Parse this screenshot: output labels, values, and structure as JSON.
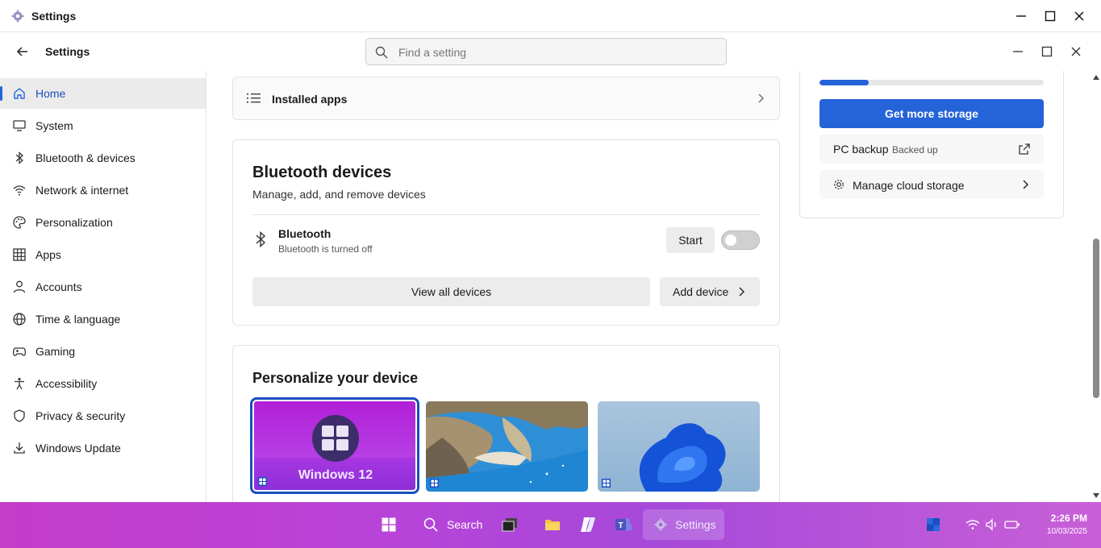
{
  "window": {
    "title": "Settings"
  },
  "header": {
    "title": "Settings",
    "search_placeholder": "Find a setting"
  },
  "sidebar": {
    "items": [
      {
        "label": "Home",
        "icon": "home-icon",
        "active": true
      },
      {
        "label": "System",
        "icon": "monitor-icon"
      },
      {
        "label": "Bluetooth & devices",
        "icon": "bluetooth-icon"
      },
      {
        "label": "Network & internet",
        "icon": "wifi-icon"
      },
      {
        "label": "Personalization",
        "icon": "palette-icon"
      },
      {
        "label": "Apps",
        "icon": "apps-grid-icon"
      },
      {
        "label": "Accounts",
        "icon": "person-icon"
      },
      {
        "label": "Time & language",
        "icon": "globe-icon"
      },
      {
        "label": "Gaming",
        "icon": "gamepad-icon"
      },
      {
        "label": "Accessibility",
        "icon": "accessibility-icon"
      },
      {
        "label": "Privacy & security",
        "icon": "shield-icon"
      },
      {
        "label": "Windows Update",
        "icon": "download-icon"
      }
    ]
  },
  "main": {
    "installed_apps": {
      "label": "Installed apps"
    },
    "bluetooth": {
      "title": "Bluetooth devices",
      "subtitle": "Manage, add, and remove devices",
      "device_name": "Bluetooth",
      "device_status": "Bluetooth is turned off",
      "start_label": "Start",
      "toggle_on": false,
      "view_all_label": "View all devices",
      "add_device_label": "Add device"
    },
    "personalize": {
      "title": "Personalize your device",
      "wallpaper_text": "Windows 12",
      "wallpapers": [
        "windows-12-wallpaper",
        "beach-cove-wallpaper",
        "blue-bloom-wallpaper"
      ],
      "selected_index": 0
    }
  },
  "storage": {
    "usage_fraction": 0.22,
    "get_more_label": "Get more storage",
    "pc_backup_label": "PC backup",
    "pc_backup_status": "Backed up",
    "manage_label": "Manage cloud storage"
  },
  "taskbar": {
    "search_label": "Search",
    "settings_label": "Settings",
    "time": "2:26 PM",
    "date": "10/03/2025"
  },
  "colors": {
    "accent": "#2563d9",
    "taskbar": "#b843d9"
  }
}
